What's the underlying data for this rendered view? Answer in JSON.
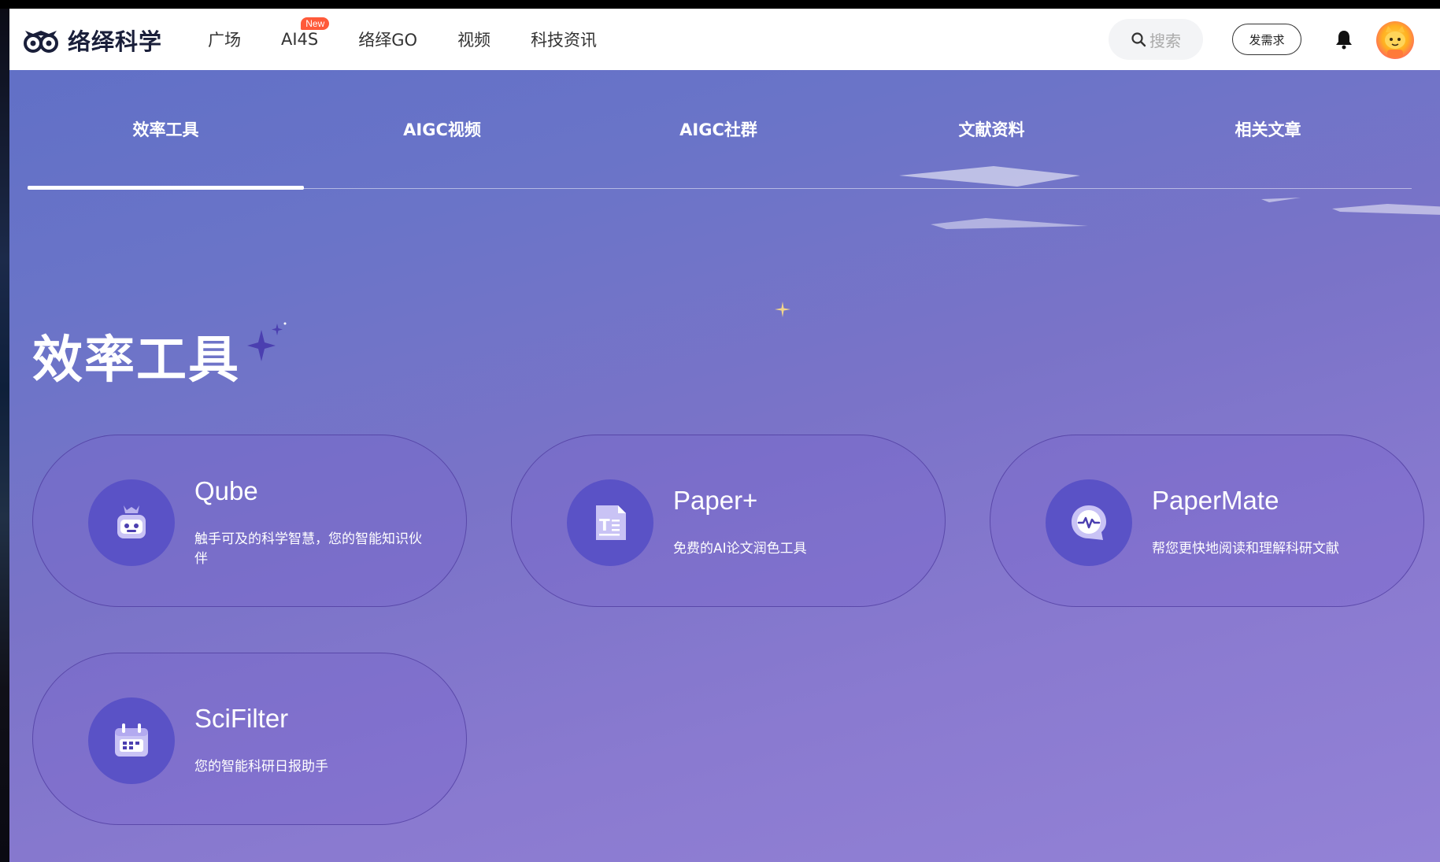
{
  "header": {
    "logo_text": "络绎科学",
    "nav": [
      {
        "label": "广场"
      },
      {
        "label": "AI4S",
        "badge": "New"
      },
      {
        "label": "络绎GO"
      },
      {
        "label": "视频"
      },
      {
        "label": "科技资讯"
      }
    ],
    "search_placeholder": "搜索",
    "request_button": "发需求"
  },
  "tabs": [
    {
      "label": "效率工具",
      "active": true
    },
    {
      "label": "AIGC视频",
      "active": false
    },
    {
      "label": "AIGC社群",
      "active": false
    },
    {
      "label": "文献资料",
      "active": false
    },
    {
      "label": "相关文章",
      "active": false
    }
  ],
  "section": {
    "title": "效率工具"
  },
  "cards": [
    {
      "title": "Qube",
      "description": "触手可及的科学智慧，您的智能知识伙伴",
      "icon": "robot-icon"
    },
    {
      "title": "Paper+",
      "description": "免费的AI论文润色工具",
      "icon": "document-text-icon"
    },
    {
      "title": "PaperMate",
      "description": "帮您更快地阅读和理解科研文献",
      "icon": "chat-pulse-icon"
    },
    {
      "title": "SciFilter",
      "description": "您的智能科研日报助手",
      "icon": "calendar-icon"
    }
  ],
  "colors": {
    "icon_circle": "#5a52c6",
    "badge": "#ff5a3a",
    "page_gradient_start": "#5f6fc6",
    "page_gradient_end": "#9382d6"
  }
}
